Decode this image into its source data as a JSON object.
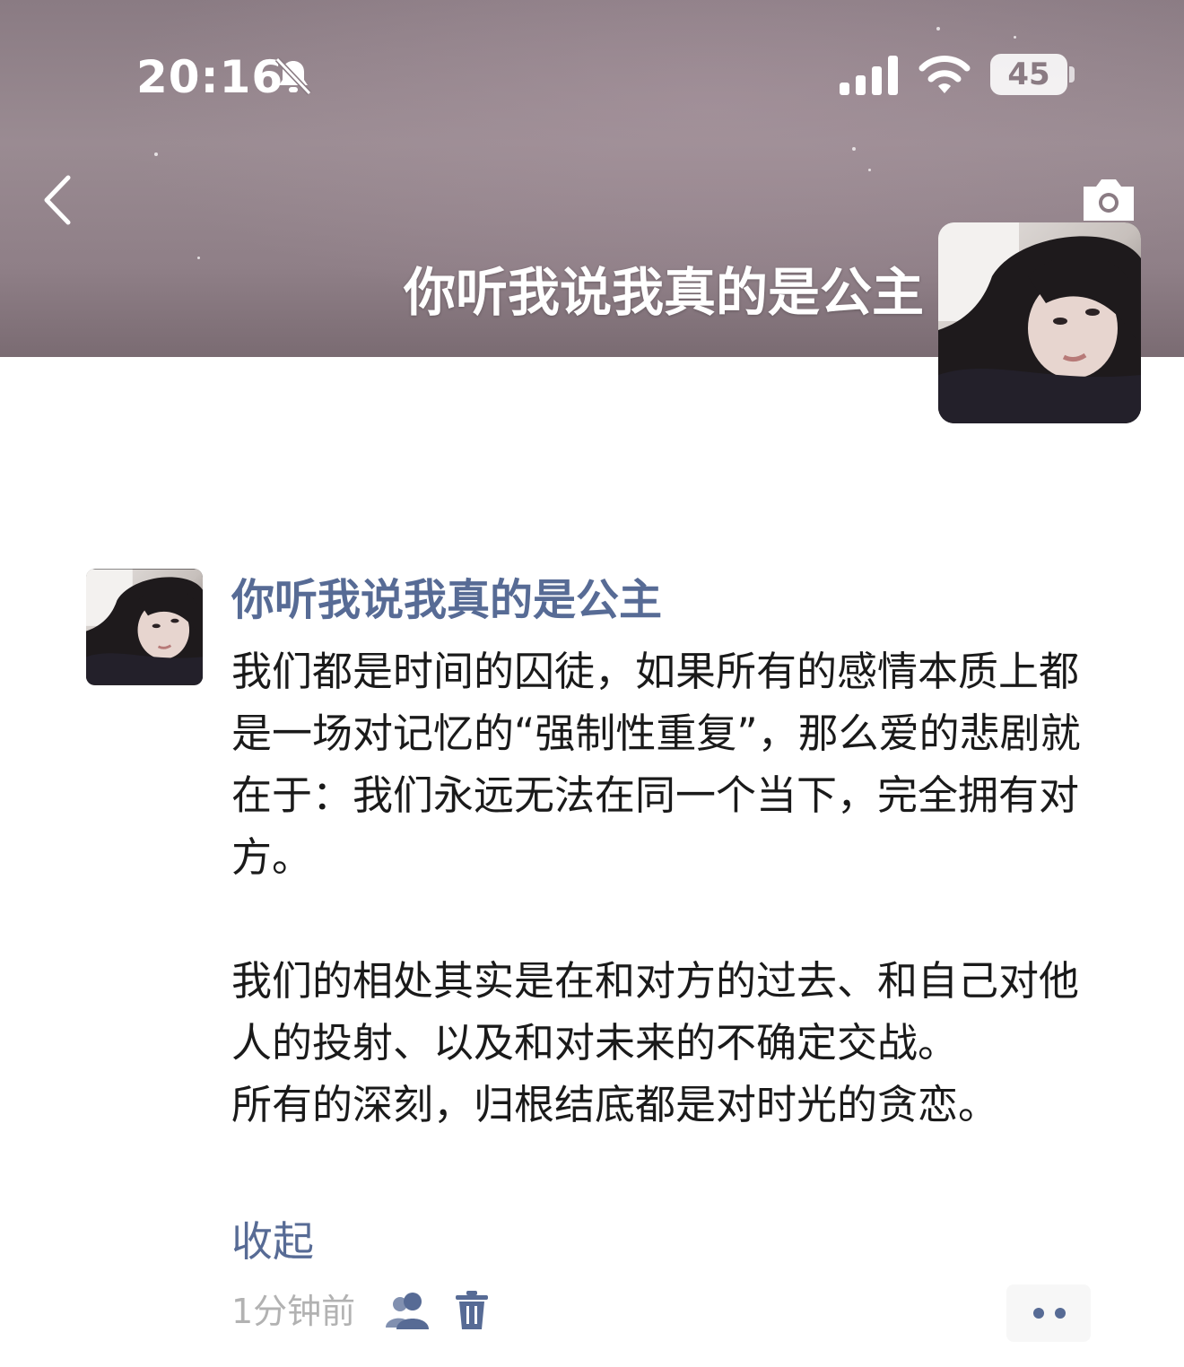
{
  "status_bar": {
    "time": "20:16",
    "icons": [
      "bell-slash-icon",
      "signal-icon",
      "wifi-icon"
    ],
    "battery": "45"
  },
  "header": {
    "back_icon": "chevron-left-icon",
    "camera_icon": "camera-icon",
    "cover_name": "你听我说我真的是公主",
    "profile_avatar": "profile-photo"
  },
  "post": {
    "author": "你听我说我真的是公主",
    "paragraphs": [
      "我们都是时间的囚徒，如果所有的感情本质上都是一场对记忆的“强制性重复”，那么爱的悲剧就在于：我们永远无法在同一个当下，完全拥有对方。",
      "我们的相处其实是在和对方的过去、和自己对他人的投射、以及和对未来的不确定交战。",
      "所有的深刻，归根结底都是对时光的贪恋。"
    ],
    "collapse_label": "收起",
    "time_ago": "1分钟前",
    "visibility_icon": "friends-icon",
    "delete_icon": "trash-icon",
    "more_icon": "more-dots-icon"
  },
  "colors": {
    "link": "#576b95",
    "meta": "#b2b2b2",
    "text": "#1a1a1a",
    "cover": "#8f7f87"
  }
}
